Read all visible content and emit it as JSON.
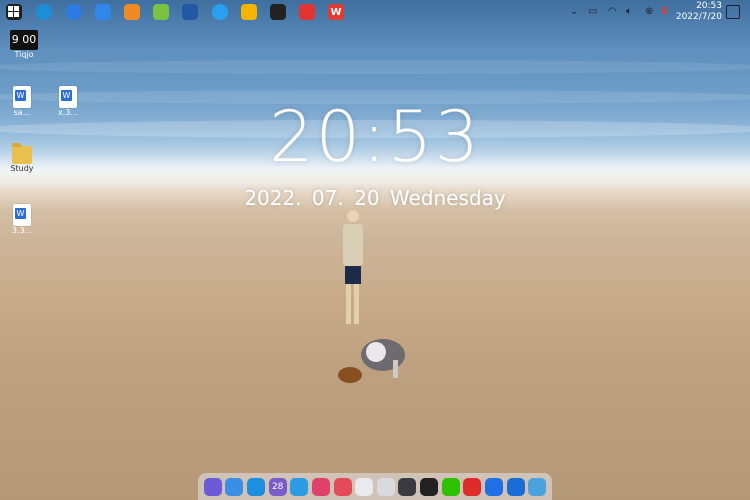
{
  "desktop": {
    "lock_time": "20:53",
    "lock_date": "2022. 07. 20  Wednesday",
    "icons": [
      {
        "name": "clock-widget",
        "label": "Tiqjo",
        "glyph": "9 00"
      },
      {
        "name": "word-doc-1",
        "label": "sa..."
      },
      {
        "name": "word-doc-2",
        "label": "x.3..."
      },
      {
        "name": "folder-study",
        "label": "Study"
      },
      {
        "name": "word-doc-3",
        "label": "3.3..."
      }
    ]
  },
  "topbar": {
    "apps": [
      {
        "icon": "windows-icon",
        "color": "#1e1e1e"
      },
      {
        "icon": "edge-icon",
        "color": "#1a8fd6"
      },
      {
        "icon": "browser-icon",
        "color": "#2c7be5"
      },
      {
        "icon": "cloud-icon",
        "color": "#2f88e8"
      },
      {
        "icon": "flame-icon",
        "color": "#f08a24"
      },
      {
        "icon": "photos-icon",
        "color": "#7cc242"
      },
      {
        "icon": "mail-icon",
        "color": "#2358a6"
      },
      {
        "icon": "chat-icon",
        "color": "#2aa0f0"
      },
      {
        "icon": "folder-icon",
        "color": "#f4b400"
      },
      {
        "icon": "app-icon",
        "color": "#222"
      },
      {
        "icon": "red-app-icon",
        "color": "#e3342f"
      },
      {
        "icon": "wps-icon",
        "color": "#e23b2e"
      }
    ],
    "tray_time": "20:53",
    "tray_date": "2022/7/20",
    "tray_s": "S"
  },
  "dock": {
    "items": [
      {
        "icon": "rocket-icon",
        "color": "#6b5bd6",
        "label": ""
      },
      {
        "icon": "finder-icon",
        "color": "#3a8ee6",
        "label": ""
      },
      {
        "icon": "safari-icon",
        "color": "#1d8fe1",
        "label": ""
      },
      {
        "icon": "calendar-icon",
        "color": "#7a5cc9",
        "label": "28"
      },
      {
        "icon": "search-icon",
        "color": "#2d9be4",
        "label": ""
      },
      {
        "icon": "sketch-icon",
        "color": "#e0416b",
        "label": ""
      },
      {
        "icon": "photo-icon",
        "color": "#e44b5a",
        "label": ""
      },
      {
        "icon": "grid-icon",
        "color": "#e9e9ee",
        "label": ""
      },
      {
        "icon": "more-icon",
        "color": "#d9d9e0",
        "label": ""
      },
      {
        "icon": "power-icon",
        "color": "#3a3a40",
        "label": ""
      },
      {
        "icon": "qq-icon",
        "color": "#222",
        "label": ""
      },
      {
        "icon": "wechat-icon",
        "color": "#2dc100",
        "label": ""
      },
      {
        "icon": "netease-icon",
        "color": "#e02b2b",
        "label": ""
      },
      {
        "icon": "feishu-icon",
        "color": "#1f6fe5",
        "label": ""
      },
      {
        "icon": "thunder-icon",
        "color": "#1b6dd6",
        "label": ""
      },
      {
        "icon": "trash-icon",
        "color": "#4aa3df",
        "label": ""
      }
    ]
  }
}
